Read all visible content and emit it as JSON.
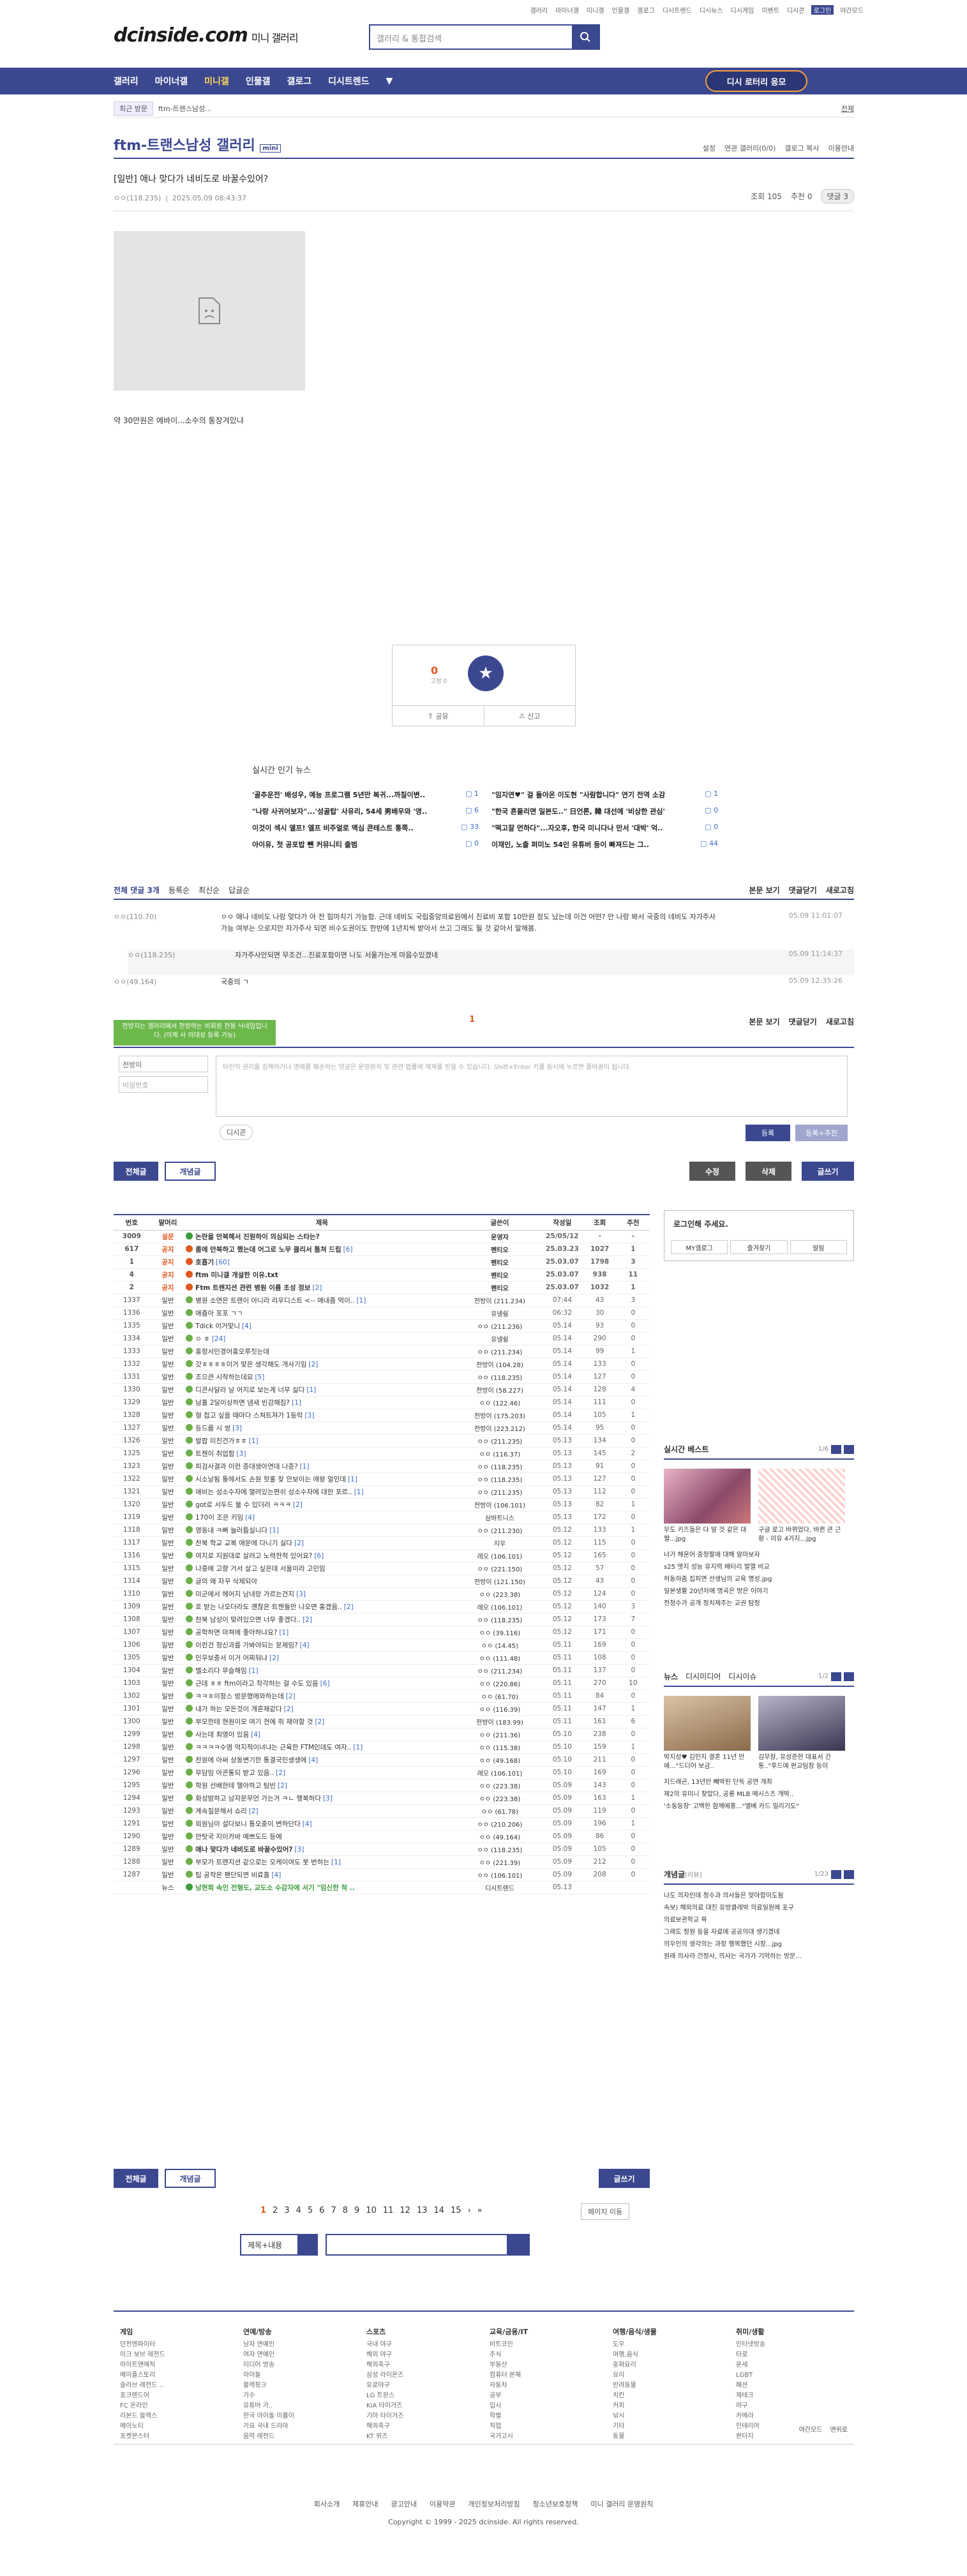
{
  "top_links": [
    "갤러리",
    "마이너갤",
    "미니갤",
    "인물갤",
    "갤로그",
    "디시트렌드",
    "디시뉴스",
    "디시게임",
    "이벤트",
    "디시콘",
    "로그인",
    "야간모드"
  ],
  "logo": {
    "main": "dcinside.com",
    "sub": "미니 갤러리"
  },
  "search": {
    "placeholder": "갤러리 & 통합검색"
  },
  "gnb": {
    "items": [
      "갤러리",
      "마이너갤",
      "미니갤",
      "인물갤",
      "갤로그",
      "디시트렌드"
    ],
    "cta": "디시 로터리 응모"
  },
  "subbar": {
    "recent": "최근 방문",
    "tag": "ftm-트랜스남성...",
    "all": "전체"
  },
  "gallery": {
    "title": "ftm-트랜스남성 갤러리",
    "badge": "mini",
    "menu": [
      "설정",
      "연관 갤러리(0/0)",
      "갤로그 복사",
      "이용안내"
    ]
  },
  "post": {
    "title": "[일반] 애나 맞다가 네비도로 바꿀수있어?",
    "author": "ㅇㅇ(118.235)",
    "date": "2025.05.09 08:43:37",
    "views": "조회 105",
    "recs": "추천 0",
    "comments_btn": "댓글 3",
    "body": "약 30만원은 에바이...소수의 통장겨있냐"
  },
  "vote": {
    "up": "0",
    "fix": "고정 0",
    "share": "공유",
    "report": "신고"
  },
  "news": {
    "title": "실시간 인기 뉴스",
    "items": [
      {
        "t": "'골추운전' 배성우, 예능 프로그램 5년만 복귀...까칠이변..",
        "c": "1"
      },
      {
        "t": "\"임지연♥\" 걸 돌아온 이도현 \"사람합니다\" 연기 전역 소감",
        "c": "1"
      },
      {
        "t": "\"나랑 사귀어보자\"...'성골탑' 사유리, 54세 男배우와 '영..",
        "c": "6"
      },
      {
        "t": "\"한국 흔들리면 일본도..\" 日언론, 韓 대선에 '비상한 관심'",
        "c": "0"
      },
      {
        "t": "이것이 섹시 엘프! 엘프 비주얼로 맥심 콘테스트 통쪽..",
        "c": "33"
      },
      {
        "t": "\"떡고잘 먼하다\"...자오후, 한국 미니다나 만서 '대박' 억..",
        "c": "0"
      },
      {
        "t": "아이유, 첫 공포밥 뺀 커뮤니티 출범",
        "c": "0"
      },
      {
        "t": "이재인, 노출 퍼미노 54인 유튜버 등이 빠져드는 그..",
        "c": "44"
      }
    ]
  },
  "comments": {
    "head": "전체 댓글 3개",
    "sort": [
      "등록순",
      "최신순",
      "답글순"
    ],
    "right": [
      "본문 보기",
      "댓글닫기",
      "새로고침"
    ],
    "items": [
      {
        "who": "ㅇㅇ(110.70)",
        "body": "ㅇㅇ 애나 네비도 나랑 맞다가 아 전 힘마치기 가능함. 근데 네비도 국립중앙의료원에서 진료비 포함 10만원 정도 났는데 이건 어떤? 안 나랑 봐서 국중의 네비도 자가주사 가능 여부는 으로지만 자가주사 되면 비수도권이도 한반에 1년치씩 받아서 쓰고 그래도 될 것 같아서 말해봄.",
        "date": "05.09 11:01:07"
      },
      {
        "who": "ㅇㅇ(118.235)",
        "body": "자가주사안되면 무조건...진료포함이면 나도 서울가는게 마음수있겠네",
        "date": "05.09 11:14:37"
      },
      {
        "who": "ㅇㅇ(49.164)",
        "body": "국중의 ㄱ",
        "date": "05.09 12:35:26"
      }
    ],
    "page": "1"
  },
  "toast": "전방지는 갤러리에서 전방하는 비회원 전용 닉네임입니다. (이제 사 이대성 등록 가능)",
  "write": {
    "name": "전방이",
    "pw": "비밀번호",
    "placeholder": "타인의 권리를 침해하거나 명예를 훼손하는 댓글은 운영원칙 및 관련 법률에 제재를 받을 수 있습니다.\nShift+Enter 키를 동시에 누르면 줄바꿈이 됩니다.",
    "dccon": "디시콘",
    "submit": "등록",
    "submit2": "등록+추천"
  },
  "buttons": {
    "all": "전체글",
    "popular": "개념글",
    "edit": "수정",
    "delete": "삭제",
    "write": "글쓰기"
  },
  "list": {
    "headers": [
      "번호",
      "말머리",
      "제목",
      "글쓴이",
      "작성일",
      "조회",
      "추천"
    ],
    "rows": [
      {
        "n": "3009",
        "h": "설문",
        "t": "논란을 만북해서 진원하이 의심되는 스타는?",
        "c": "",
        "w": "운영자",
        "d": "25/05/12",
        "v": "-",
        "r": "-",
        "k": "notice"
      },
      {
        "n": "617",
        "h": "공지",
        "t": "룸에 만북하고 했는데 어그로 노무 클리서 톰쳐 드립",
        "c": "[6]",
        "w": "펜티오",
        "d": "25.03.23",
        "v": "1027",
        "r": "1",
        "k": "notice"
      },
      {
        "n": "1",
        "h": "공지",
        "t": "호흡기",
        "c": "[60]",
        "w": "펜티오",
        "d": "25.03.07",
        "v": "1798",
        "r": "3",
        "k": "notice"
      },
      {
        "n": "4",
        "h": "공지",
        "t": "ftm 미니갤 개설한 이유.txt",
        "c": "",
        "w": "펜티오",
        "d": "25.03.07",
        "v": "938",
        "r": "11",
        "k": "notice"
      },
      {
        "n": "2",
        "h": "공지",
        "t": "Ftm 트랜지션 관련 병원 이름 초성 정보",
        "c": "[2]",
        "w": "펜티오",
        "d": "25.03.07",
        "v": "1032",
        "r": "1",
        "k": "notice"
      },
      {
        "n": "1337",
        "h": "일반",
        "t": "병원 소연은 트랜이 아니라 리우디스트 <-- 애내좀 먹이..",
        "c": "[1]",
        "w": "전방이 (211.234)",
        "d": "07:44",
        "v": "43",
        "r": "3",
        "k": ""
      },
      {
        "n": "1336",
        "h": "일반",
        "t": "애쥼아 포포 ㄱㄱ",
        "c": "",
        "w": "유넬쉴",
        "d": "06:32",
        "v": "30",
        "r": "0",
        "k": ""
      },
      {
        "n": "1335",
        "h": "일반",
        "t": "Tdick 이거맞니",
        "c": "[4]",
        "w": "ㅇㅇ (211.236)",
        "d": "05.14",
        "v": "93",
        "r": "0",
        "k": ""
      },
      {
        "n": "1334",
        "h": "일반",
        "t": "ㅇ ㅎ",
        "c": "[24]",
        "w": "유넬쉴",
        "d": "05.14",
        "v": "290",
        "r": "0",
        "k": ""
      },
      {
        "n": "1333",
        "h": "일반",
        "t": "홍정서인경어홍오루짓는데",
        "c": "",
        "w": "ㅇㅇ (211.234)",
        "d": "05.14",
        "v": "99",
        "r": "1",
        "k": ""
      },
      {
        "n": "1332",
        "h": "일반",
        "t": "갓ㅎㅎㅎㅎ이거 맞은 생각해도 개사기임",
        "c": "[2]",
        "w": "전방이 (104.28)",
        "d": "05.14",
        "v": "133",
        "r": "0",
        "k": ""
      },
      {
        "n": "1331",
        "h": "일반",
        "t": "조으큰 시작하는데요",
        "c": "[5]",
        "w": "ㅇㅇ (118.235)",
        "d": "05.14",
        "v": "127",
        "r": "0",
        "k": ""
      },
      {
        "n": "1330",
        "h": "일반",
        "t": "디콘사달라 날 어지로 보는게 너무 싫다",
        "c": "[1]",
        "w": "전방이 (58.227)",
        "d": "05.14",
        "v": "128",
        "r": "4",
        "k": ""
      },
      {
        "n": "1329",
        "h": "일반",
        "t": "남홀 2달이상하면 냄새 빈감해짐?",
        "c": "[1]",
        "w": "ㅇㅇ (122.46)",
        "d": "05.14",
        "v": "111",
        "r": "0",
        "k": ""
      },
      {
        "n": "1328",
        "h": "일반",
        "t": "형 접고 싶을 때마다 스쳐트져가 1등락",
        "c": "[3]",
        "w": "전방이 (175.203)",
        "d": "05.14",
        "v": "105",
        "r": "1",
        "k": ""
      },
      {
        "n": "1327",
        "h": "일반",
        "t": "등드름 시 쌍",
        "c": "[3]",
        "w": "전방이 (223.212)",
        "d": "05.14",
        "v": "95",
        "r": "0",
        "k": ""
      },
      {
        "n": "1326",
        "h": "일반",
        "t": "발팝 미친건가ㅎㅎ",
        "c": "[1]",
        "w": "ㅇㅇ (211.235)",
        "d": "05.13",
        "v": "134",
        "r": "0",
        "k": ""
      },
      {
        "n": "1325",
        "h": "일반",
        "t": "트젠이 취업함",
        "c": "[3]",
        "w": "ㅇㅇ (116.37)",
        "d": "05.13",
        "v": "145",
        "r": "2",
        "k": ""
      },
      {
        "n": "1323",
        "h": "일반",
        "t": "피검사결과 이런 증대생아연데 나증?",
        "c": "[1]",
        "w": "ㅇㅇ (118.235)",
        "d": "05.13",
        "v": "91",
        "r": "0",
        "k": ""
      },
      {
        "n": "1322",
        "h": "일반",
        "t": "시소날됨 통에서도 손원 핫홀 찾 안보이는 애왕 얼인데",
        "c": "[1]",
        "w": "ㅇㅇ (118.235)",
        "d": "05.13",
        "v": "127",
        "r": "0",
        "k": ""
      },
      {
        "n": "1321",
        "h": "일반",
        "t": "애비는 성소수자에 열려있는편쉬 성소수자에 대한 포르..",
        "c": "[1]",
        "w": "ㅇㅇ (211.235)",
        "d": "05.13",
        "v": "112",
        "r": "0",
        "k": ""
      },
      {
        "n": "1320",
        "h": "일반",
        "t": "got로 서두드 물 수 있더러 ㅋㅋㅋ",
        "c": "[2]",
        "w": "전방이 (106.101)",
        "d": "05.13",
        "v": "82",
        "r": "1",
        "k": ""
      },
      {
        "n": "1319",
        "h": "일반",
        "t": "170이 조은 키임",
        "c": "[4]",
        "w": "삼바트니스",
        "d": "05.13",
        "v": "172",
        "r": "0",
        "k": ""
      },
      {
        "n": "1318",
        "h": "일반",
        "t": "영동내 ㅋ뻐 늘러틈실니다",
        "c": "[1]",
        "w": "ㅇㅇ (211.230)",
        "d": "05.12",
        "v": "133",
        "r": "1",
        "k": ""
      },
      {
        "n": "1317",
        "h": "일반",
        "t": "찬북 학교 교복 애문에 다니기 싫다",
        "c": "[2]",
        "w": "지우",
        "d": "05.12",
        "v": "115",
        "r": "0",
        "k": ""
      },
      {
        "n": "1316",
        "h": "일반",
        "t": "여지로 지원대로 살려고 노력한적 있어요?",
        "c": "[6]",
        "w": "레오 (106.101)",
        "d": "05.12",
        "v": "165",
        "r": "0",
        "k": ""
      },
      {
        "n": "1315",
        "h": "일반",
        "t": "나중에 고향 거서 살고 싶은데 서울이라 고민임",
        "c": "",
        "w": "ㅇㅇ (221.150)",
        "d": "05.12",
        "v": "57",
        "r": "0",
        "k": ""
      },
      {
        "n": "1314",
        "h": "일반",
        "t": "글의 왜 자꾸 삭제되아",
        "c": "",
        "w": "전방이 (121.150)",
        "d": "05.12",
        "v": "43",
        "r": "0",
        "k": ""
      },
      {
        "n": "1310",
        "h": "일반",
        "t": "미군에서 헤어지 남내랑 가르는건지",
        "c": "[3]",
        "w": "ㅇㅇ (223.38)",
        "d": "05.12",
        "v": "124",
        "r": "0",
        "k": ""
      },
      {
        "n": "1309",
        "h": "일반",
        "t": "호 받는 나오더라도 괜찮은 트젠들만 나오면 홍겠음..",
        "c": "[2]",
        "w": "레오 (106.101)",
        "d": "05.12",
        "v": "140",
        "r": "3",
        "k": ""
      },
      {
        "n": "1308",
        "h": "일반",
        "t": "찬북 남성이 맞려있으면 너무 좋겠다..",
        "c": "[2]",
        "w": "ㅇㅇ (118.235)",
        "d": "05.12",
        "v": "173",
        "r": "7",
        "k": ""
      },
      {
        "n": "1307",
        "h": "일반",
        "t": "공학하면 마쳐에 좋아하냐요?",
        "c": "[1]",
        "w": "ㅇㅇ (39.116)",
        "d": "05.12",
        "v": "171",
        "r": "0",
        "k": ""
      },
      {
        "n": "1306",
        "h": "일반",
        "t": "이런건 정신과를 가봐야되는 문제임?",
        "c": "[4]",
        "w": "ㅇㅇ (14.45)",
        "d": "05.11",
        "v": "169",
        "r": "0",
        "k": ""
      },
      {
        "n": "1305",
        "h": "일반",
        "t": "인우보충서 이거 어찌둬냐",
        "c": "[2]",
        "w": "ㅇㅇ (111.48)",
        "d": "05.11",
        "v": "108",
        "r": "0",
        "k": ""
      },
      {
        "n": "1304",
        "h": "일반",
        "t": "벨소리다 무슬해임",
        "c": "[1]",
        "w": "ㅇㅇ (211.234)",
        "d": "05.11",
        "v": "137",
        "r": "0",
        "k": ""
      },
      {
        "n": "1303",
        "h": "일반",
        "t": "근데 ㅎㅎ ftm이라고 착각하는 걸 수도 있음",
        "c": "[6]",
        "w": "ㅇㅇ (220.86)",
        "d": "05.11",
        "v": "270",
        "r": "10",
        "k": ""
      },
      {
        "n": "1302",
        "h": "일반",
        "t": "ㅋㅋㅎ이정스 방문했에와하는데",
        "c": "[2]",
        "w": "ㅇㅇ (61.70)",
        "d": "05.11",
        "v": "84",
        "r": "0",
        "k": ""
      },
      {
        "n": "1301",
        "h": "일반",
        "t": "내가 하는 모든것이 개혼재같다",
        "c": "[2]",
        "w": "ㅇㅇ (116.39)",
        "d": "05.11",
        "v": "147",
        "r": "1",
        "k": ""
      },
      {
        "n": "1300",
        "h": "일반",
        "t": "부모한테 현원이모 여기 전에 쥐 재야할 것",
        "c": "[2]",
        "w": "전방이 (183.99)",
        "d": "05.11",
        "v": "161",
        "r": "6",
        "k": ""
      },
      {
        "n": "1299",
        "h": "일반",
        "t": "사는데 최영이 있음",
        "c": "[4]",
        "w": "ㅇㅇ (211.36)",
        "d": "05.10",
        "v": "238",
        "r": "0",
        "k": ""
      },
      {
        "n": "1298",
        "h": "일반",
        "t": "ㅋㅋㅋㅋ수염 억지적이녀냐는 근육한 FTM인데도 여자..",
        "c": "[1]",
        "w": "ㅇㅇ (115.38)",
        "d": "05.10",
        "v": "159",
        "r": "1",
        "k": ""
      },
      {
        "n": "1297",
        "h": "일반",
        "t": "찬원에 아써 상동변기한 통결국민생생에",
        "c": "[4]",
        "w": "ㅇㅇ (49.168)",
        "d": "05.10",
        "v": "211",
        "r": "0",
        "k": ""
      },
      {
        "n": "1296",
        "h": "일반",
        "t": "무담임 아콘통되 받고 있음..",
        "c": "[2]",
        "w": "레오 (106.101)",
        "d": "05.10",
        "v": "169",
        "r": "0",
        "k": ""
      },
      {
        "n": "1295",
        "h": "일반",
        "t": "학원 선배한테 헬아하고 탐빈",
        "c": "[2]",
        "w": "ㅇㅇ (223.38)",
        "d": "05.09",
        "v": "143",
        "r": "0",
        "k": ""
      },
      {
        "n": "1294",
        "h": "일반",
        "t": "화성밤하고 남자문무언 가는거 ㅋㄴ 행복하다",
        "c": "[3]",
        "w": "ㅇㅇ (223.38)",
        "d": "05.09",
        "v": "163",
        "r": "1",
        "k": ""
      },
      {
        "n": "1293",
        "h": "일반",
        "t": "계속질문해서 쇼리",
        "c": "[2]",
        "w": "ㅇㅇ (61.78)",
        "d": "05.09",
        "v": "119",
        "r": "0",
        "k": ""
      },
      {
        "n": "1291",
        "h": "일반",
        "t": "외원님이 설다보니 통오중이 변하단다",
        "c": "[4]",
        "w": "ㅇㅇ (210.206)",
        "d": "05.09",
        "v": "196",
        "r": "1",
        "k": ""
      },
      {
        "n": "1290",
        "h": "일반",
        "t": "안탓국 지이카바 예쁘도드 등에",
        "c": "",
        "w": "ㅇㅇ (49.164)",
        "d": "05.09",
        "v": "86",
        "r": "0",
        "k": ""
      },
      {
        "n": "1289",
        "h": "일반",
        "t": "애나 맞다가 네비도로 바꿀수있어?",
        "c": "[3]",
        "w": "ㅇㅇ (118.235)",
        "d": "05.09",
        "v": "105",
        "r": "0",
        "k": "current"
      },
      {
        "n": "1288",
        "h": "일반",
        "t": "부모가 트랜지션 같으로는 오케이여도 못 번하는",
        "c": "[1]",
        "w": "ㅇㅇ (221.39)",
        "d": "05.09",
        "v": "212",
        "r": "0",
        "k": ""
      },
      {
        "n": "1287",
        "h": "일반",
        "t": "팁 공작은 팬단되면 비료흘",
        "c": "[4]",
        "w": "ㅇㅇ (106.101)",
        "d": "05.09",
        "v": "208",
        "r": "0",
        "k": ""
      },
      {
        "n": "",
        "h": "뉴스",
        "t": "낭현희 속인 전형도, 교도소 수감자에 서기 \"임신한 척 ..",
        "c": "",
        "w": "디시트렌드",
        "d": "05.13",
        "v": "",
        "r": "",
        "k": "news"
      }
    ]
  },
  "side": {
    "login": {
      "title": "로그인해 주세요.",
      "buttons": [
        "MY갤로그",
        "즐겨찾기",
        "알림"
      ]
    },
    "best": {
      "title": "실시간 베스트",
      "page": "1/6",
      "caps": [
        "무도 키즈들은 다 알 것 같은 대 짤...jpg",
        "구글 로고 바뀌었다, 바뀐 큰 근황 - 이유 4가지...jpg"
      ],
      "list": [
        "너가 해운어 중청팔에 대해 알아보자",
        "s25 엣지 성능 유지력 배터리 발열 비교",
        "허동하줌 집피면 선생님의 교육 명성.jpg",
        "일본생활 20년차에 명곡은 방은 이야기",
        "전청수가 공개 정치제주는 교권 탐정"
      ]
    },
    "news": {
      "tabs": [
        "뉴스",
        "디시미디어",
        "디시이슈"
      ],
      "page": "1/2",
      "caps": [
        "박지성♥ 김민지 결혼 11년 만에...\"드디어 보금..",
        "김무창, 유성준한 대표서 간통..\"후드에 판교팀장 등이"
      ],
      "list": [
        "지드래곤, 13년만 빼박된 단독 공연 개최",
        "제2의 유미니 찾았다, 공룡 MLB 메시스츠 개박..",
        "'소동등장' 고백한 함께에홍...\"엘베 카드 밀리기도\""
      ]
    },
    "concept": {
      "title": "개념글",
      "tag": "리뷰",
      "page": "1/23",
      "list": [
        "나도 의자인데 정수과 의사들은 맞아합이도됨",
        "속보) 해외의료 대진 유방클레박 의료일원에 포구",
        "의료보관학교 목",
        "그래도 정원 등을 자료에 공공의대 생기겠네",
        "의우인의 생각의는 과장 행복했던 시장...jpg",
        "원래 의사라 건정사, 의사는 국가가 기억하는 방문..."
      ]
    }
  },
  "bottom_buttons": {
    "all": "전체글",
    "popular": "개념글",
    "write": "글쓰기",
    "page_move": "페이지 이동"
  },
  "pager": [
    "1",
    "2",
    "3",
    "4",
    "5",
    "6",
    "7",
    "8",
    "9",
    "10",
    "11",
    "12",
    "13",
    "14",
    "15"
  ],
  "fsearch": {
    "select": "제목+내용"
  },
  "footer": {
    "cols": [
      {
        "h": "게임",
        "items": [
          "던전앤파이터",
          "미크 보브 레전드",
          "마이트앤매직",
          "메이플스토리",
          "슬라브 레전드 ..",
          "포크렌드어",
          "FC 온라인",
          "리본드 블랙스",
          "메이노티",
          "포켓몬스터"
        ]
      },
      {
        "h": "연예/방송",
        "items": [
          "남자 연예인",
          "여자 연예인",
          "미디어 방송",
          "아이돌",
          "블랙핑크",
          "가수",
          "유튜버 가..",
          "한국 아이돌 미롤이",
          "가요 국내 드라마",
          "음악 레전드"
        ]
      },
      {
        "h": "스포츠",
        "items": [
          "국내 야구",
          "해외 야구",
          "해외축구",
          "삼성 라이온즈",
          "유로야구",
          "LG 트윈스",
          "KIA 타이거즈",
          "기아 타이거즈",
          "해외축구",
          "KT 위즈"
        ]
      },
      {
        "h": "교육/금융/IT",
        "items": [
          "비트코인",
          "주식",
          "부동산",
          "컴퓨터 본체",
          "자동차",
          "공부",
          "입시",
          "학벌",
          "직업",
          "국가고시"
        ]
      },
      {
        "h": "여행/음식/생물",
        "items": [
          "도우",
          "여행,음식",
          "중화요리",
          "요리",
          "반려동물",
          "치킨",
          "커피",
          "낚시",
          "기타",
          "동물"
        ]
      },
      {
        "h": "취미/생활",
        "items": [
          "인터넷방송",
          "타로",
          "운세",
          "LGBT",
          "패션",
          "제테크",
          "야구",
          "카메라",
          "인테리어",
          "판타지"
        ]
      }
    ],
    "corner": [
      "야간모드",
      "맨위로"
    ],
    "links": [
      "회사소개",
      "제휴안내",
      "광고안내",
      "이용약관",
      "개인정보처리방침",
      "청소년보호정책",
      "미니 갤러리 운영원칙"
    ],
    "copyright": "Copyright © 1999 - 2025 dcinside. All rights reserved."
  }
}
